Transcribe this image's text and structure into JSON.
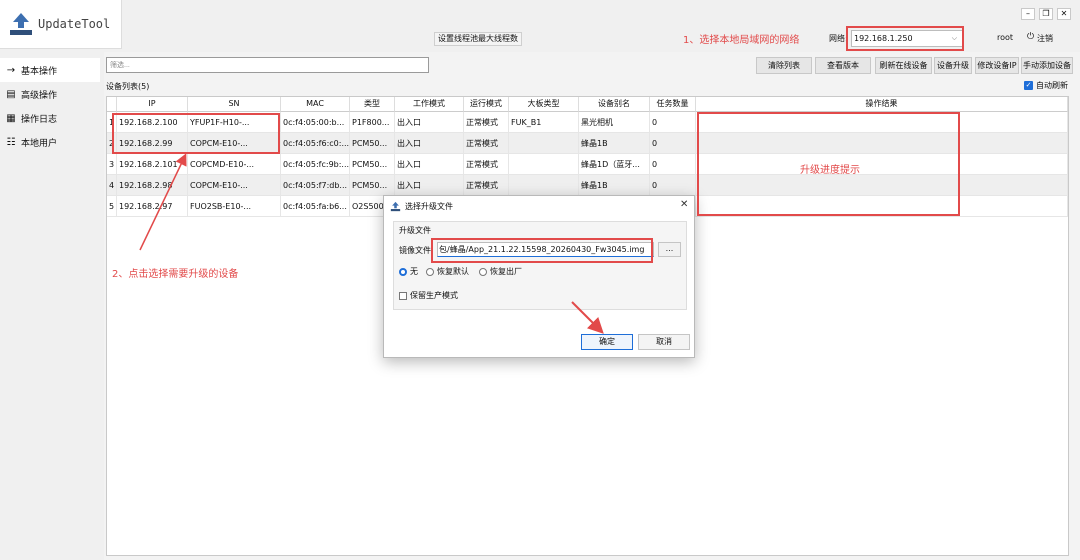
{
  "app": {
    "title": "UpdateTool"
  },
  "header": {
    "thread_button": "设置线程池最大线程数",
    "network_label": "网络:",
    "network_value": "192.168.1.250",
    "user": "root",
    "logout": "注销"
  },
  "sidebar": {
    "items": [
      {
        "label": "基本操作",
        "icon": "arrow-right-icon",
        "active": true
      },
      {
        "label": "高级操作",
        "icon": "panel-icon"
      },
      {
        "label": "操作日志",
        "icon": "document-icon"
      },
      {
        "label": "本地用户",
        "icon": "users-icon"
      }
    ]
  },
  "main": {
    "filter_placeholder": "筛选...",
    "toolbar": [
      "清除列表",
      "查看版本",
      "刷新在线设备",
      "设备升级",
      "修改设备IP",
      "手动添加设备"
    ],
    "device_list_label": "设备列表(5)",
    "auto_refresh": "自动刷新",
    "table": {
      "columns": [
        "IP",
        "SN",
        "MAC",
        "类型",
        "工作模式",
        "运行模式",
        "大板类型",
        "设备别名",
        "任务数量",
        "操作结果"
      ],
      "rows": [
        [
          "1",
          "192.168.2.100",
          "YFUP1F-H10-...",
          "0c:f4:05:00:b...",
          "P1F800...",
          "出入口",
          "正常模式",
          "FUK_B1",
          "黑光相机",
          "0",
          ""
        ],
        [
          "2",
          "192.168.2.99",
          "COPCM-E10-...",
          "0c:f4:05:f6:c0:...",
          "PCM50...",
          "出入口",
          "正常模式",
          "",
          "蜂晶1B",
          "0",
          ""
        ],
        [
          "3",
          "192.168.2.101",
          "COPCMD-E10-...",
          "0c:f4:05:fc:9b:...",
          "PCM50...",
          "出入口",
          "正常模式",
          "",
          "蜂晶1D（蓝牙...",
          "0",
          ""
        ],
        [
          "4",
          "192.168.2.98",
          "COPCM-E10-...",
          "0c:f4:05:f7:db...",
          "PCM50...",
          "出入口",
          "正常模式",
          "",
          "蜂晶1B",
          "0",
          ""
        ],
        [
          "5",
          "192.168.2.97",
          "FUO2SB-E10-...",
          "0c:f4:05:fa:b6...",
          "O2S500",
          "",
          "",
          "",
          "",
          "",
          ""
        ]
      ]
    }
  },
  "dialog": {
    "title": "选择升级文件",
    "group_title": "升级文件",
    "file_label": "镜像文件",
    "file_value": "包/蜂晶/App_21.1.22.15598_20260430_Fw3045.img",
    "browse": "...",
    "radios": [
      "无",
      "恢复默认",
      "恢复出厂"
    ],
    "keep_mode": "保留生产模式",
    "ok": "确定",
    "cancel": "取消"
  },
  "annotations": {
    "step1": "1、选择本地局域网的网络",
    "step2": "2、点击选择需要升级的设备",
    "progress": "升级进度提示"
  },
  "colors": {
    "accent": "#1e6ed8",
    "annotation": "#e24a4a"
  }
}
